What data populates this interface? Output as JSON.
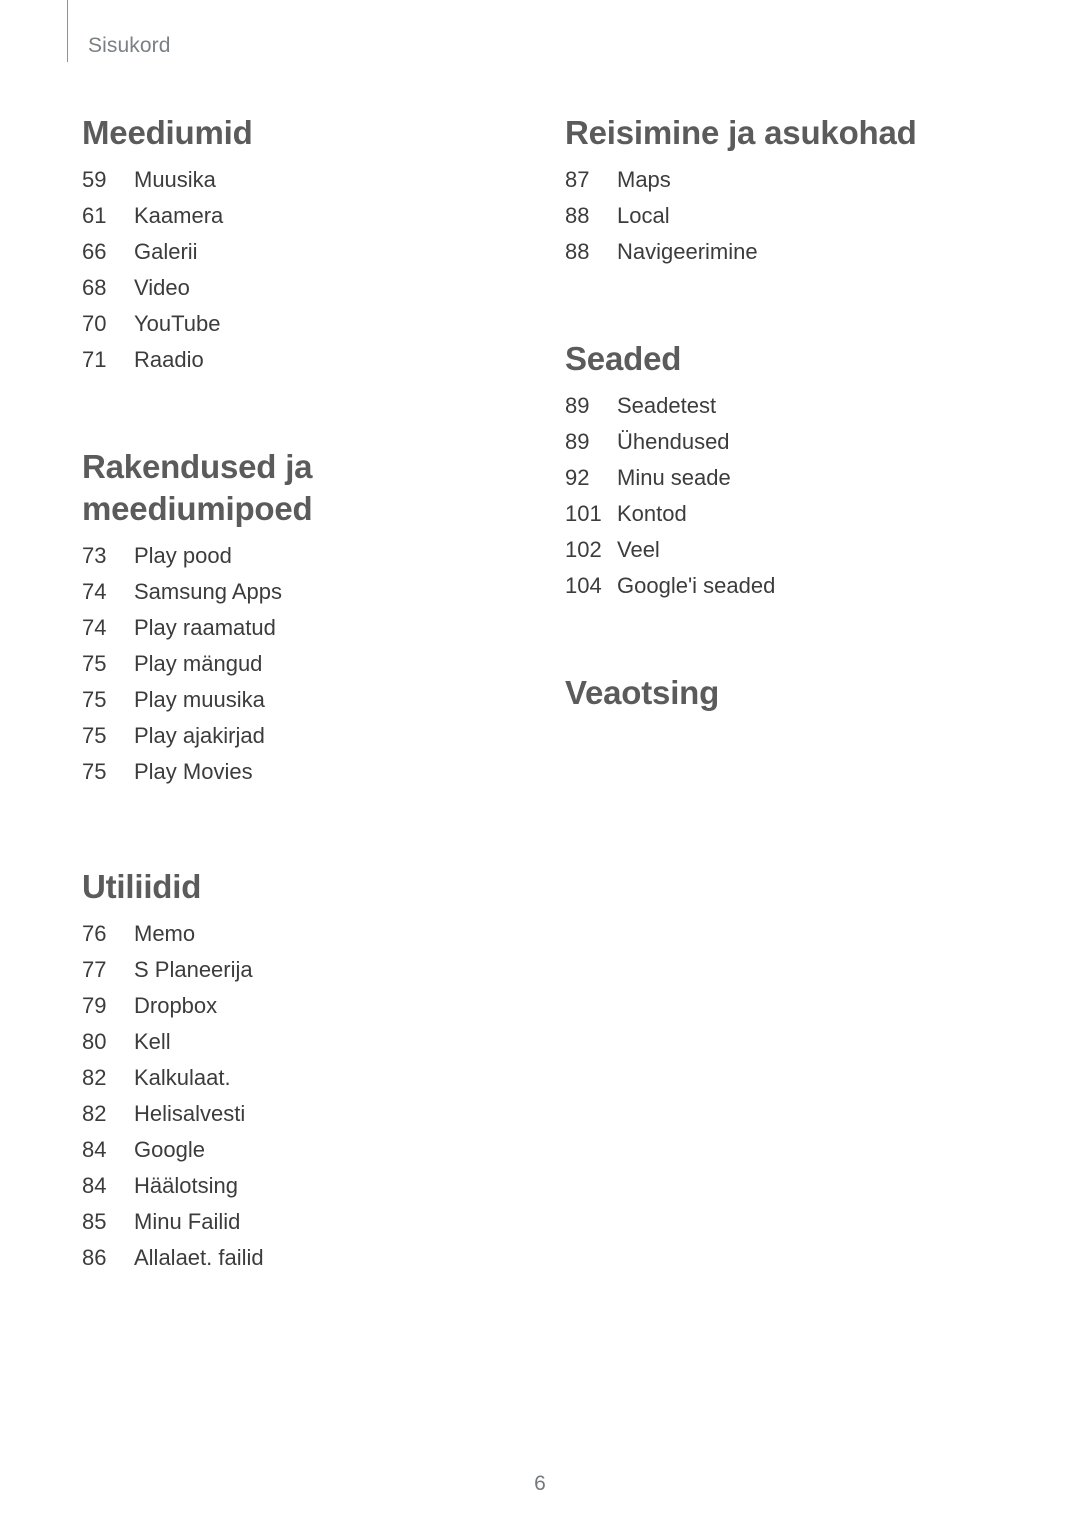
{
  "header": {
    "running_label": "Sisukord"
  },
  "footer": {
    "page_number": "6"
  },
  "columns": {
    "left": [
      {
        "title": "Meediumid",
        "entries": [
          {
            "page": "59",
            "label": "Muusika"
          },
          {
            "page": "61",
            "label": "Kaamera"
          },
          {
            "page": "66",
            "label": "Galerii"
          },
          {
            "page": "68",
            "label": "Video"
          },
          {
            "page": "70",
            "label": "YouTube"
          },
          {
            "page": "71",
            "label": "Raadio"
          }
        ]
      },
      {
        "title": "Rakendused ja meediumipoed",
        "entries": [
          {
            "page": "73",
            "label": "Play pood"
          },
          {
            "page": "74",
            "label": "Samsung Apps"
          },
          {
            "page": "74",
            "label": "Play raamatud"
          },
          {
            "page": "75",
            "label": "Play mängud"
          },
          {
            "page": "75",
            "label": "Play muusika"
          },
          {
            "page": "75",
            "label": "Play ajakirjad"
          },
          {
            "page": "75",
            "label": "Play Movies"
          }
        ]
      },
      {
        "title": "Utiliidid",
        "entries": [
          {
            "page": "76",
            "label": "Memo"
          },
          {
            "page": "77",
            "label": "S Planeerija"
          },
          {
            "page": "79",
            "label": "Dropbox"
          },
          {
            "page": "80",
            "label": "Kell"
          },
          {
            "page": "82",
            "label": "Kalkulaat."
          },
          {
            "page": "82",
            "label": "Helisalvesti"
          },
          {
            "page": "84",
            "label": "Google"
          },
          {
            "page": "84",
            "label": "Häälotsing"
          },
          {
            "page": "85",
            "label": "Minu Failid"
          },
          {
            "page": "86",
            "label": "Allalaet. failid"
          }
        ]
      }
    ],
    "right": [
      {
        "title": "Reisimine ja asukohad",
        "entries": [
          {
            "page": "87",
            "label": "Maps"
          },
          {
            "page": "88",
            "label": "Local"
          },
          {
            "page": "88",
            "label": "Navigeerimine"
          }
        ]
      },
      {
        "title": "Seaded",
        "entries": [
          {
            "page": "89",
            "label": "Seadetest"
          },
          {
            "page": "89",
            "label": "Ühendused"
          },
          {
            "page": "92",
            "label": "Minu seade"
          },
          {
            "page": "101",
            "label": "Kontod"
          },
          {
            "page": "102",
            "label": "Veel"
          },
          {
            "page": "104",
            "label": "Google'i seaded"
          }
        ]
      },
      {
        "title": "Veaotsing",
        "entries": []
      }
    ]
  },
  "colors": {
    "heading": "#5b5b5b",
    "body": "#3c3c3c",
    "running_header": "#7b8084",
    "rule": "#8d9295",
    "background": "#ffffff"
  }
}
